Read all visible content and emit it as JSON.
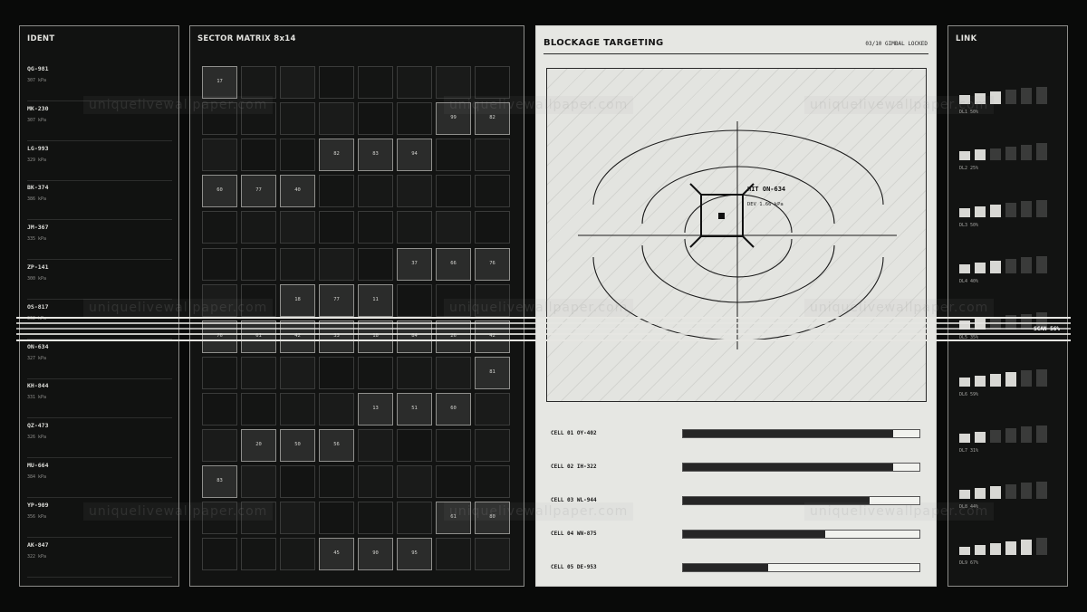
{
  "ident": {
    "title": "IDENT",
    "items": [
      {
        "code": "QG-981",
        "value": "307 kPa"
      },
      {
        "code": "MK-230",
        "value": "307 kPa"
      },
      {
        "code": "LG-993",
        "value": "329 kPa"
      },
      {
        "code": "BK-374",
        "value": "386 kPa"
      },
      {
        "code": "JM-367",
        "value": "335 kPa"
      },
      {
        "code": "ZP-141",
        "value": "300 kPa"
      },
      {
        "code": "OS-817",
        "value": "362 kPa"
      },
      {
        "code": "ON-634",
        "value": "327 kPa"
      },
      {
        "code": "KH-844",
        "value": "331 kPa"
      },
      {
        "code": "QZ-473",
        "value": "326 kPa"
      },
      {
        "code": "MU-664",
        "value": "384 kPa"
      },
      {
        "code": "YP-909",
        "value": "356 kPa"
      },
      {
        "code": "AK-847",
        "value": "322 kPa"
      }
    ]
  },
  "matrix": {
    "title": "SECTOR MATRIX  8x14",
    "cols": 8,
    "rows": 14,
    "lit": [
      {
        "r": 0,
        "c": 0,
        "v": "17"
      },
      {
        "r": 1,
        "c": 6,
        "v": "99"
      },
      {
        "r": 1,
        "c": 7,
        "v": "82"
      },
      {
        "r": 2,
        "c": 3,
        "v": "82"
      },
      {
        "r": 2,
        "c": 4,
        "v": "83"
      },
      {
        "r": 2,
        "c": 5,
        "v": "94"
      },
      {
        "r": 3,
        "c": 0,
        "v": "60"
      },
      {
        "r": 3,
        "c": 1,
        "v": "77"
      },
      {
        "r": 3,
        "c": 2,
        "v": "40"
      },
      {
        "r": 5,
        "c": 5,
        "v": "37"
      },
      {
        "r": 5,
        "c": 6,
        "v": "66"
      },
      {
        "r": 5,
        "c": 7,
        "v": "76"
      },
      {
        "r": 6,
        "c": 2,
        "v": "18"
      },
      {
        "r": 6,
        "c": 3,
        "v": "77"
      },
      {
        "r": 6,
        "c": 4,
        "v": "11"
      },
      {
        "r": 7,
        "c": 0,
        "v": "76"
      },
      {
        "r": 7,
        "c": 1,
        "v": "61"
      },
      {
        "r": 7,
        "c": 2,
        "v": "42"
      },
      {
        "r": 7,
        "c": 3,
        "v": "33"
      },
      {
        "r": 7,
        "c": 4,
        "v": "18"
      },
      {
        "r": 7,
        "c": 5,
        "v": "84"
      },
      {
        "r": 7,
        "c": 6,
        "v": "26"
      },
      {
        "r": 7,
        "c": 7,
        "v": "42"
      },
      {
        "r": 8,
        "c": 7,
        "v": "81"
      },
      {
        "r": 9,
        "c": 4,
        "v": "13"
      },
      {
        "r": 9,
        "c": 5,
        "v": "51"
      },
      {
        "r": 9,
        "c": 6,
        "v": "60"
      },
      {
        "r": 10,
        "c": 1,
        "v": "20"
      },
      {
        "r": 10,
        "c": 2,
        "v": "50"
      },
      {
        "r": 10,
        "c": 3,
        "v": "56"
      },
      {
        "r": 11,
        "c": 0,
        "v": "83"
      },
      {
        "r": 12,
        "c": 6,
        "v": "61"
      },
      {
        "r": 12,
        "c": 7,
        "v": "80"
      },
      {
        "r": 13,
        "c": 3,
        "v": "45"
      },
      {
        "r": 13,
        "c": 4,
        "v": "90"
      },
      {
        "r": 13,
        "c": 5,
        "v": "95"
      }
    ]
  },
  "targeting": {
    "title": "BLOCKAGE TARGETING",
    "status": "03/10  GIMBAL LOCKED",
    "hit_label": "HIT ON-634",
    "dev_label": "DEV 1.66 kPa",
    "cells": [
      {
        "label": "CELL 01  OY-402",
        "fill": 0.89
      },
      {
        "label": "CELL 02  IH-322",
        "fill": 0.89
      },
      {
        "label": "CELL 03  WL-944",
        "fill": 0.79
      },
      {
        "label": "CELL 04  WN-875",
        "fill": 0.6
      },
      {
        "label": "CELL 05  DE-953",
        "fill": 0.36
      }
    ]
  },
  "link": {
    "title": "LINK",
    "rows": [
      {
        "label": "DL1 50%",
        "bars": [
          0.3,
          0.45,
          0.6,
          0.75,
          0.9,
          1.0
        ],
        "on": 3
      },
      {
        "label": "DL2 25%",
        "bars": [
          0.3,
          0.45,
          0.6,
          0.75,
          0.9,
          1.0
        ],
        "on": 2
      },
      {
        "label": "DL3 50%",
        "bars": [
          0.3,
          0.45,
          0.6,
          0.75,
          0.9,
          1.0
        ],
        "on": 3
      },
      {
        "label": "DL4 40%",
        "bars": [
          0.3,
          0.45,
          0.6,
          0.75,
          0.9,
          1.0
        ],
        "on": 3
      },
      {
        "label": "DL5 35%",
        "bars": [
          0.3,
          0.45,
          0.6,
          0.75,
          0.9,
          1.0
        ],
        "on": 2
      },
      {
        "label": "DL6 59%",
        "bars": [
          0.3,
          0.45,
          0.6,
          0.75,
          0.9,
          1.0
        ],
        "on": 4
      },
      {
        "label": "DL7 31%",
        "bars": [
          0.3,
          0.45,
          0.6,
          0.75,
          0.9,
          1.0
        ],
        "on": 2
      },
      {
        "label": "DL8 44%",
        "bars": [
          0.3,
          0.45,
          0.6,
          0.75,
          0.9,
          1.0
        ],
        "on": 3
      },
      {
        "label": "DL9 67%",
        "bars": [
          0.3,
          0.45,
          0.6,
          0.75,
          0.9,
          1.0
        ],
        "on": 5
      }
    ]
  },
  "scan": {
    "label": "SCAN 56%"
  },
  "watermark": "uniquelivewallpaper.com"
}
